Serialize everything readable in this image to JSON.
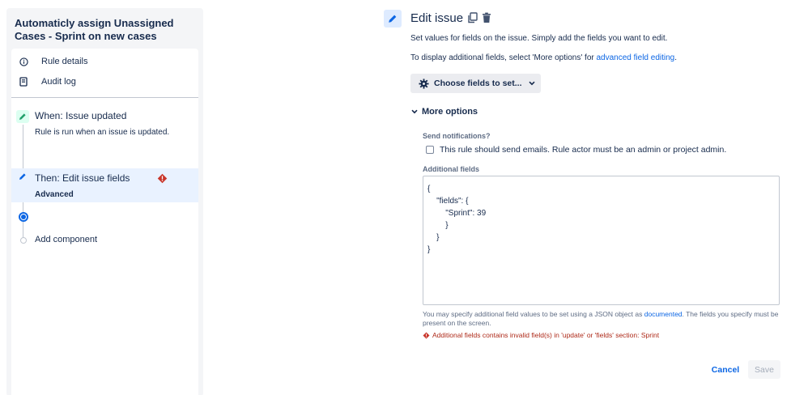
{
  "sidebar": {
    "rule_title": "Automaticly assign Unassigned Cases - Sprint on new cases",
    "items": [
      {
        "label": "Rule details",
        "icon": "info-icon"
      },
      {
        "label": "Audit log",
        "icon": "audit-log-icon"
      }
    ],
    "trigger": {
      "title": "When: Issue updated",
      "subtitle": "Rule is run when an issue is updated.",
      "icon": "pencil-icon",
      "color": "#57d9a3"
    },
    "action": {
      "title": "Then: Edit issue fields",
      "subtitle": "Advanced",
      "icon": "pencil-icon",
      "status_icon": "error-icon",
      "selected": true
    },
    "add_component_label": "Add component"
  },
  "main": {
    "title": "Edit issue",
    "description": "Set values for fields on the issue. Simply add the fields you want to edit.",
    "display_prefix": "To display additional fields, select 'More options' for ",
    "display_link": "advanced field editing",
    "display_suffix": ".",
    "choose_fields_label": "Choose fields to set...",
    "more_options_label": "More options",
    "send_notifications_label": "Send notifications?",
    "send_notifications_checkbox_label": "This rule should send emails. Rule actor must be an admin or project admin.",
    "send_notifications_checked": false,
    "additional_fields_label": "Additional fields",
    "additional_fields_lines": [
      "{",
      "    \"fields\": {",
      "        \"Sprint\": 39",
      "        }",
      "    }",
      "}"
    ],
    "help_prefix": "You may specify additional field values to be set using a JSON object as ",
    "help_link": "documented",
    "help_suffix": ". The fields you specify must be present on the screen.",
    "error_message": "Additional fields contains invalid field(s) in 'update' or 'fields' section: Sprint",
    "cancel_label": "Cancel",
    "save_label": "Save"
  },
  "colors": {
    "accent": "#0c66e4",
    "error": "#c9372c",
    "selected_bg": "#e9f2ff",
    "trigger_green": "#57d9a3"
  }
}
